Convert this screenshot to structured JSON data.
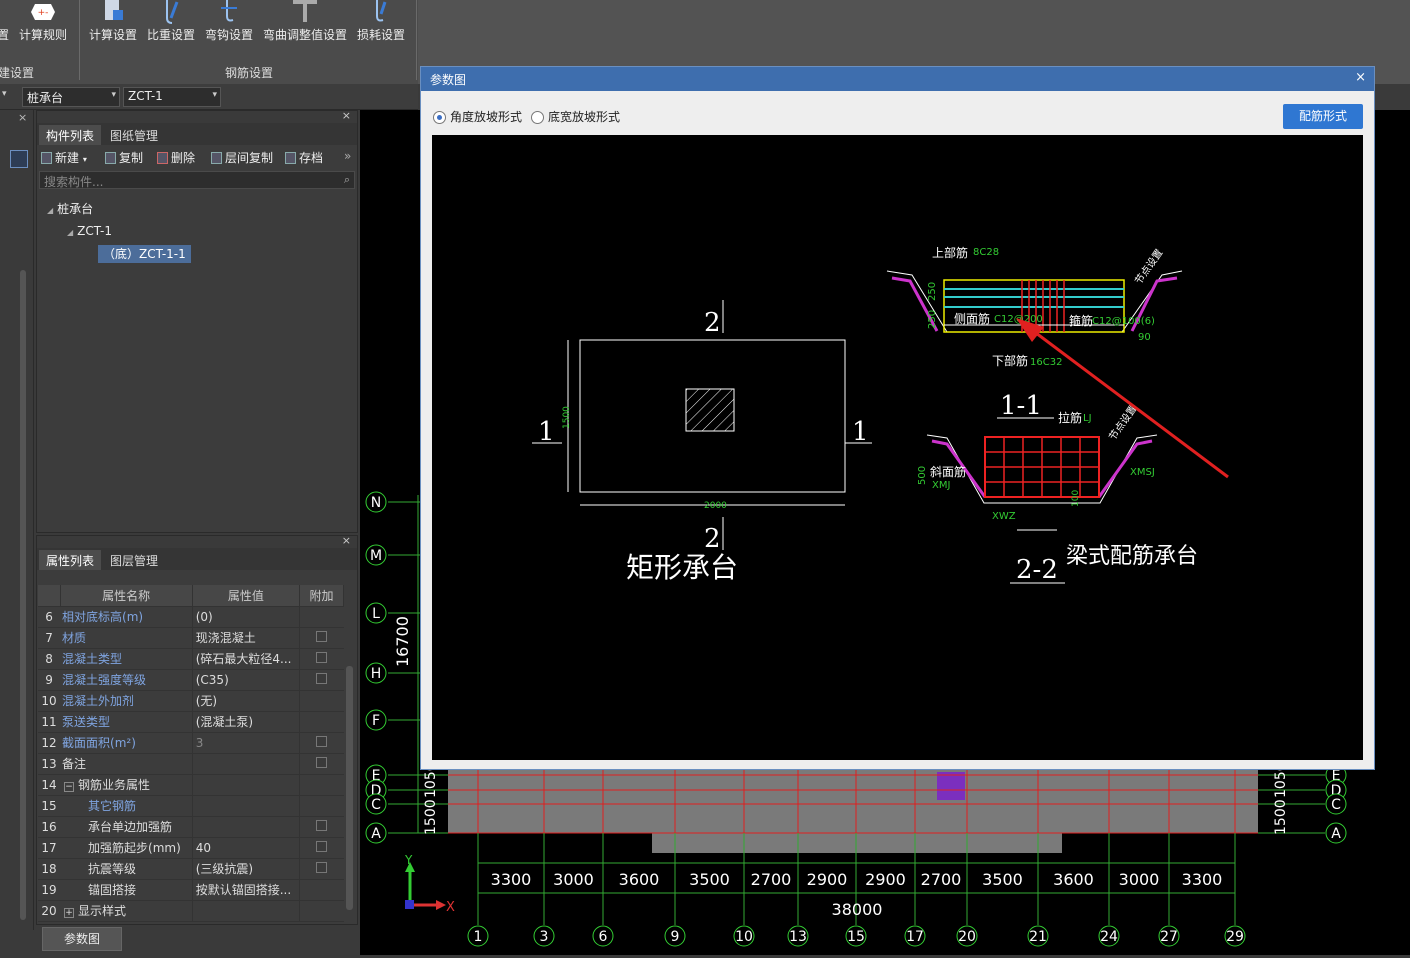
{
  "ribbon": {
    "buttons": [
      {
        "label": "置"
      },
      {
        "label": "计算规则"
      },
      {
        "label": "计算设置"
      },
      {
        "label": "比重设置"
      },
      {
        "label": "弯钩设置"
      },
      {
        "label": "弯曲调整值设置"
      },
      {
        "label": "损耗设置"
      }
    ],
    "groups": [
      {
        "label": "土建设置"
      },
      {
        "label": "钢筋设置"
      }
    ]
  },
  "selectors": {
    "type": "桩承台",
    "name": "ZCT-1"
  },
  "component_panel": {
    "tabs": [
      "构件列表",
      "图纸管理"
    ],
    "toolbar": {
      "new": "新建",
      "copy": "复制",
      "delete": "删除",
      "floor_copy": "层间复制",
      "save": "存档"
    },
    "search_placeholder": "搜索构件...",
    "tree": {
      "root": "桩承台",
      "child": "ZCT-1",
      "leaf": "（底）ZCT-1-1"
    }
  },
  "property_panel": {
    "tabs": [
      "属性列表",
      "图层管理"
    ],
    "columns": [
      "属性名称",
      "属性值",
      "附加"
    ],
    "rows": [
      {
        "no": "6",
        "name": "相对底标高(m)",
        "value": "(0)",
        "check": false
      },
      {
        "no": "7",
        "name": "材质",
        "value": "现浇混凝土",
        "check": true
      },
      {
        "no": "8",
        "name": "混凝土类型",
        "value": "(碎石最大粒径4...",
        "check": true
      },
      {
        "no": "9",
        "name": "混凝土强度等级",
        "value": "(C35)",
        "check": true
      },
      {
        "no": "10",
        "name": "混凝土外加剂",
        "value": "(无)",
        "check": false
      },
      {
        "no": "11",
        "name": "泵送类型",
        "value": "(混凝土泵)",
        "check": false
      },
      {
        "no": "12",
        "name": "截面面积(m²)",
        "value": "3",
        "check": true
      },
      {
        "no": "13",
        "name": "备注",
        "value": "",
        "check": true
      },
      {
        "no": "14",
        "name": "钢筋业务属性",
        "value": "",
        "check": false
      },
      {
        "no": "15",
        "name": "其它钢筋",
        "value": "",
        "check": false
      },
      {
        "no": "16",
        "name": "承台单边加强筋",
        "value": "",
        "check": true
      },
      {
        "no": "17",
        "name": "加强筋起步(mm)",
        "value": "40",
        "check": true
      },
      {
        "no": "18",
        "name": "抗震等级",
        "value": "(三级抗震)",
        "check": true
      },
      {
        "no": "19",
        "name": "锚固搭接",
        "value": "按默认锚固搭接...",
        "check": false
      },
      {
        "no": "20",
        "name": "显示样式",
        "value": "",
        "check": false
      }
    ],
    "bottom_button": "参数图"
  },
  "canvas": {
    "row_axes": [
      "N",
      "M",
      "L",
      "H",
      "F",
      "E",
      "D",
      "C",
      "A"
    ],
    "left_dim": "16700",
    "col_dims": [
      "3300",
      "3000",
      "3600",
      "3500",
      "2700",
      "2900",
      "2900",
      "2700",
      "3500",
      "3600",
      "3000",
      "3300"
    ],
    "total_dim": "38000",
    "col_axes": [
      "1",
      "3",
      "6",
      "9",
      "10",
      "13",
      "15",
      "17",
      "20",
      "21",
      "24",
      "27",
      "29"
    ],
    "edge_dim": "1500",
    "edge_dim2": "1050",
    "axis_x": "X",
    "axis_y": "Y"
  },
  "dialog": {
    "title": "参数图",
    "close": "×",
    "radio_angle": "角度放坡形式",
    "radio_width": "底宽放坡形式",
    "selected": "angle",
    "button": "配筋形式",
    "drawing": {
      "rect_title": "矩形承台",
      "beam_title": "梁式配筋承台",
      "sec_label_2": "2",
      "sec_label_1": "1",
      "dim_1500": "1500",
      "dim_2000": "2000",
      "top_bar": "上部筋",
      "top_bar_val": "8C28",
      "side_bar": "侧面筋",
      "side_bar_val": "C12@200",
      "stirrup": "箍筋",
      "stirrup_val": "C12@100(6)",
      "bottom_bar": "下部筋",
      "bottom_bar_val": "16C32",
      "dim_250a": "250",
      "dim_250b": "250",
      "angle_90": "90",
      "node_set": "节点设置",
      "sec_11": "1-1",
      "tie_bar": "拉筋",
      "tie_bar_val": "LJ",
      "slope_bar": "斜面筋",
      "slope_bar_val": "XMJ",
      "xmsj": "XMSJ",
      "xwz": "XWZ",
      "dim_500": "500",
      "dim_100": "100",
      "sec_22": "2-2"
    }
  }
}
